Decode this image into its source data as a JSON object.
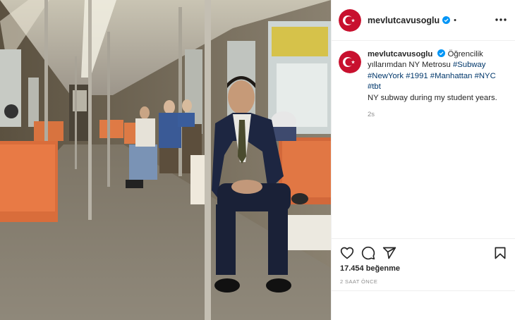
{
  "post": {
    "username": "mevlutcavusoglu",
    "dot": "•",
    "verified_icon": "verified-badge-icon",
    "more_icon": "more-options-icon",
    "accent_color": "#0095f6",
    "avatar_color": "#c8102e"
  },
  "caption": {
    "username": "mevlutcavusoglu",
    "text": "Öğrencilik yıllarımdan NY Metrosu",
    "hashtags": [
      "#Subway",
      "#NewYork",
      "#1991",
      "#Manhattan",
      "#NYC",
      "#tbt"
    ],
    "translation": "NY subway during my student years.",
    "age": "2s"
  },
  "actions": {
    "icons": [
      "heart-icon",
      "comment-icon",
      "share-icon",
      "bookmark-icon"
    ],
    "likes": "17.454 beğenme",
    "timestamp": "2 SAAT ÖNCE"
  }
}
